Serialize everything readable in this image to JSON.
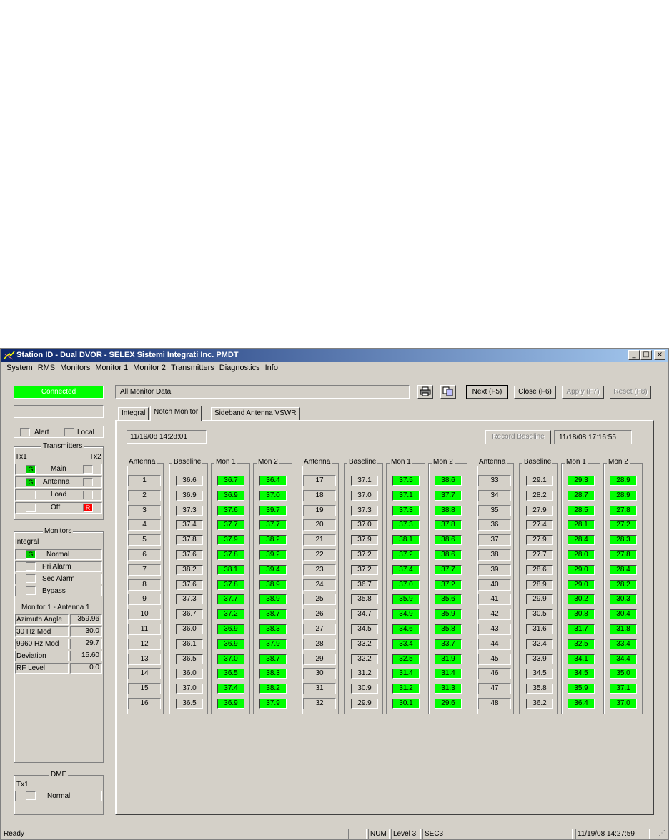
{
  "window": {
    "title": "Station ID - Dual DVOR - SELEX Sistemi Integrati Inc. PMDT",
    "controls": [
      "_",
      "□",
      "×"
    ]
  },
  "menu": [
    "System",
    "RMS",
    "Monitors",
    "Monitor 1",
    "Monitor 2",
    "Transmitters",
    "Diagnostics",
    "Info"
  ],
  "sidebar": {
    "status": "Connected",
    "alert_label": "Alert",
    "local_label": "Local",
    "transmitters": {
      "title": "Transmitters",
      "tx1": "Tx1",
      "tx2": "Tx2",
      "rows": [
        {
          "label": "Main",
          "left": "G",
          "right": ""
        },
        {
          "label": "Antenna",
          "left": "G",
          "right": ""
        },
        {
          "label": "Load",
          "left": "",
          "right": ""
        },
        {
          "label": "Off",
          "left": "",
          "right": "R"
        }
      ]
    },
    "monitors": {
      "title": "Monitors",
      "subtitle": "Integral",
      "rows": [
        {
          "label": "Normal",
          "led": "G"
        },
        {
          "label": "Pri Alarm",
          "led": ""
        },
        {
          "label": "Sec Alarm",
          "led": ""
        },
        {
          "label": "Bypass",
          "led": ""
        }
      ],
      "detail_title": "Monitor 1 - Antenna 1",
      "params": [
        {
          "label": "Azimuth Angle",
          "value": "359.96"
        },
        {
          "label": "30 Hz Mod",
          "value": "30.0"
        },
        {
          "label": "9960 Hz Mod",
          "value": "29.7"
        },
        {
          "label": "Deviation",
          "value": "15.60"
        },
        {
          "label": "RF Level",
          "value": "0.0"
        }
      ]
    },
    "dme": {
      "title": "DME",
      "tx1": "Tx1",
      "row": "Normal"
    }
  },
  "toolbar": {
    "section": "All Monitor Data",
    "print_icon": "printer-icon",
    "copy_icon": "copy-icon",
    "next": "Next (F5)",
    "close": "Close (F6)",
    "apply": "Apply (F7)",
    "reset": "Reset (F8)"
  },
  "tabs": [
    "Integral",
    "Notch Monitor",
    "Sideband Antenna VSWR"
  ],
  "notch": {
    "timestamp": "11/19/08 14:28:01",
    "record_baseline": "Record Baseline",
    "baseline_time": "11/18/08 17:16:55",
    "headers": [
      "Antenna",
      "Baseline",
      "Mon 1",
      "Mon 2"
    ],
    "rows": [
      [
        "1",
        "36.6",
        "36.7",
        "36.4"
      ],
      [
        "2",
        "36.9",
        "36.9",
        "37.0"
      ],
      [
        "3",
        "37.3",
        "37.6",
        "39.7"
      ],
      [
        "4",
        "37.4",
        "37.7",
        "37.7"
      ],
      [
        "5",
        "37.8",
        "37.9",
        "38.2"
      ],
      [
        "6",
        "37.6",
        "37.8",
        "39.2"
      ],
      [
        "7",
        "38.2",
        "38.1",
        "39.4"
      ],
      [
        "8",
        "37.6",
        "37.8",
        "38.9"
      ],
      [
        "9",
        "37.3",
        "37.7",
        "38.9"
      ],
      [
        "10",
        "36.7",
        "37.2",
        "38.7"
      ],
      [
        "11",
        "36.0",
        "36.9",
        "38.3"
      ],
      [
        "12",
        "36.1",
        "36.9",
        "37.9"
      ],
      [
        "13",
        "36.5",
        "37.0",
        "38.7"
      ],
      [
        "14",
        "36.0",
        "36.5",
        "38.3"
      ],
      [
        "15",
        "37.0",
        "37.4",
        "38.2"
      ],
      [
        "16",
        "36.5",
        "36.9",
        "37.9"
      ],
      [
        "17",
        "37.1",
        "37.5",
        "38.6"
      ],
      [
        "18",
        "37.0",
        "37.1",
        "37.7"
      ],
      [
        "19",
        "37.3",
        "37.3",
        "38.8"
      ],
      [
        "20",
        "37.0",
        "37.3",
        "37.8"
      ],
      [
        "21",
        "37.9",
        "38.1",
        "38.6"
      ],
      [
        "22",
        "37.2",
        "37.2",
        "38.6"
      ],
      [
        "23",
        "37.2",
        "37.4",
        "37.7"
      ],
      [
        "24",
        "36.7",
        "37.0",
        "37.2"
      ],
      [
        "25",
        "35.8",
        "35.9",
        "35.6"
      ],
      [
        "26",
        "34.7",
        "34.9",
        "35.9"
      ],
      [
        "27",
        "34.5",
        "34.6",
        "35.8"
      ],
      [
        "28",
        "33.2",
        "33.4",
        "33.7"
      ],
      [
        "29",
        "32.2",
        "32.5",
        "31.9"
      ],
      [
        "30",
        "31.2",
        "31.4",
        "31.4"
      ],
      [
        "31",
        "30.9",
        "31.2",
        "31.3"
      ],
      [
        "32",
        "29.9",
        "30.1",
        "29.6"
      ],
      [
        "33",
        "29.1",
        "29.3",
        "28.9"
      ],
      [
        "34",
        "28.2",
        "28.7",
        "28.9"
      ],
      [
        "35",
        "27.9",
        "28.5",
        "27.8"
      ],
      [
        "36",
        "27.4",
        "28.1",
        "27.2"
      ],
      [
        "37",
        "27.9",
        "28.4",
        "28.3"
      ],
      [
        "38",
        "27.7",
        "28.0",
        "27.8"
      ],
      [
        "39",
        "28.6",
        "29.0",
        "28.4"
      ],
      [
        "40",
        "28.9",
        "29.0",
        "28.2"
      ],
      [
        "41",
        "29.9",
        "30.2",
        "30.3"
      ],
      [
        "42",
        "30.5",
        "30.8",
        "30.4"
      ],
      [
        "43",
        "31.6",
        "31.7",
        "31.8"
      ],
      [
        "44",
        "32.4",
        "32.5",
        "33.4"
      ],
      [
        "45",
        "33.9",
        "34.1",
        "34.4"
      ],
      [
        "46",
        "34.5",
        "34.5",
        "35.0"
      ],
      [
        "47",
        "35.8",
        "35.9",
        "37.1"
      ],
      [
        "48",
        "36.2",
        "36.4",
        "37.0"
      ]
    ]
  },
  "statusbar": {
    "left": "Ready",
    "num": "NUM",
    "level": "Level 3",
    "sec": "SEC3",
    "time": "11/19/08 14:27:59"
  },
  "colors": {
    "ok_green": "#00ff00",
    "connected_green": "#00ff00",
    "alarm_red": "#ff0000",
    "title_blue": "#0a246a"
  }
}
